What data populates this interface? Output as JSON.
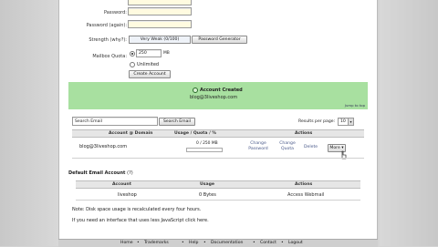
{
  "form": {
    "password_label": "Password:",
    "password_again_label": "Password (again):",
    "strength_label": "Strength (why?):",
    "strength_value": "Very Weak (0/100)",
    "password_generator_label": "Password Generator",
    "quota_label": "Mailbox Quota:",
    "quota_value": "250",
    "quota_unit": "MB",
    "unlimited_label": "Unlimited",
    "create_button": "Create Account"
  },
  "notice": {
    "title": "Account Created",
    "email": "blog@3liveshop.com",
    "top_link": "Jump to top"
  },
  "search": {
    "value": "Search Email",
    "button": "Search Email",
    "results_label": "Results per page:",
    "results_value": "10"
  },
  "accounts_table": {
    "headers": [
      "Account @ Domain",
      "Usage / Quota / %",
      "Actions"
    ],
    "rows": [
      {
        "account": "blog@3liveshop.com",
        "usage": "0 / 250 MB",
        "actions": [
          "Change Password",
          "Change Quota",
          "Delete",
          "More"
        ]
      }
    ]
  },
  "default_account": {
    "title": "Default Email Account",
    "help": "(?)",
    "headers": [
      "Account",
      "Usage",
      "Actions"
    ],
    "row": {
      "account": "liveshop",
      "usage": "0 Bytes",
      "action": "Access Webmail"
    }
  },
  "notes": {
    "note": "Note: Disk space usage is recalculated every four hours.",
    "js": "If you need an interface that uses less JavaScript click here."
  },
  "footer": [
    "Home",
    "Trademarks",
    "Help",
    "Documentation",
    "Contact",
    "Logout"
  ]
}
